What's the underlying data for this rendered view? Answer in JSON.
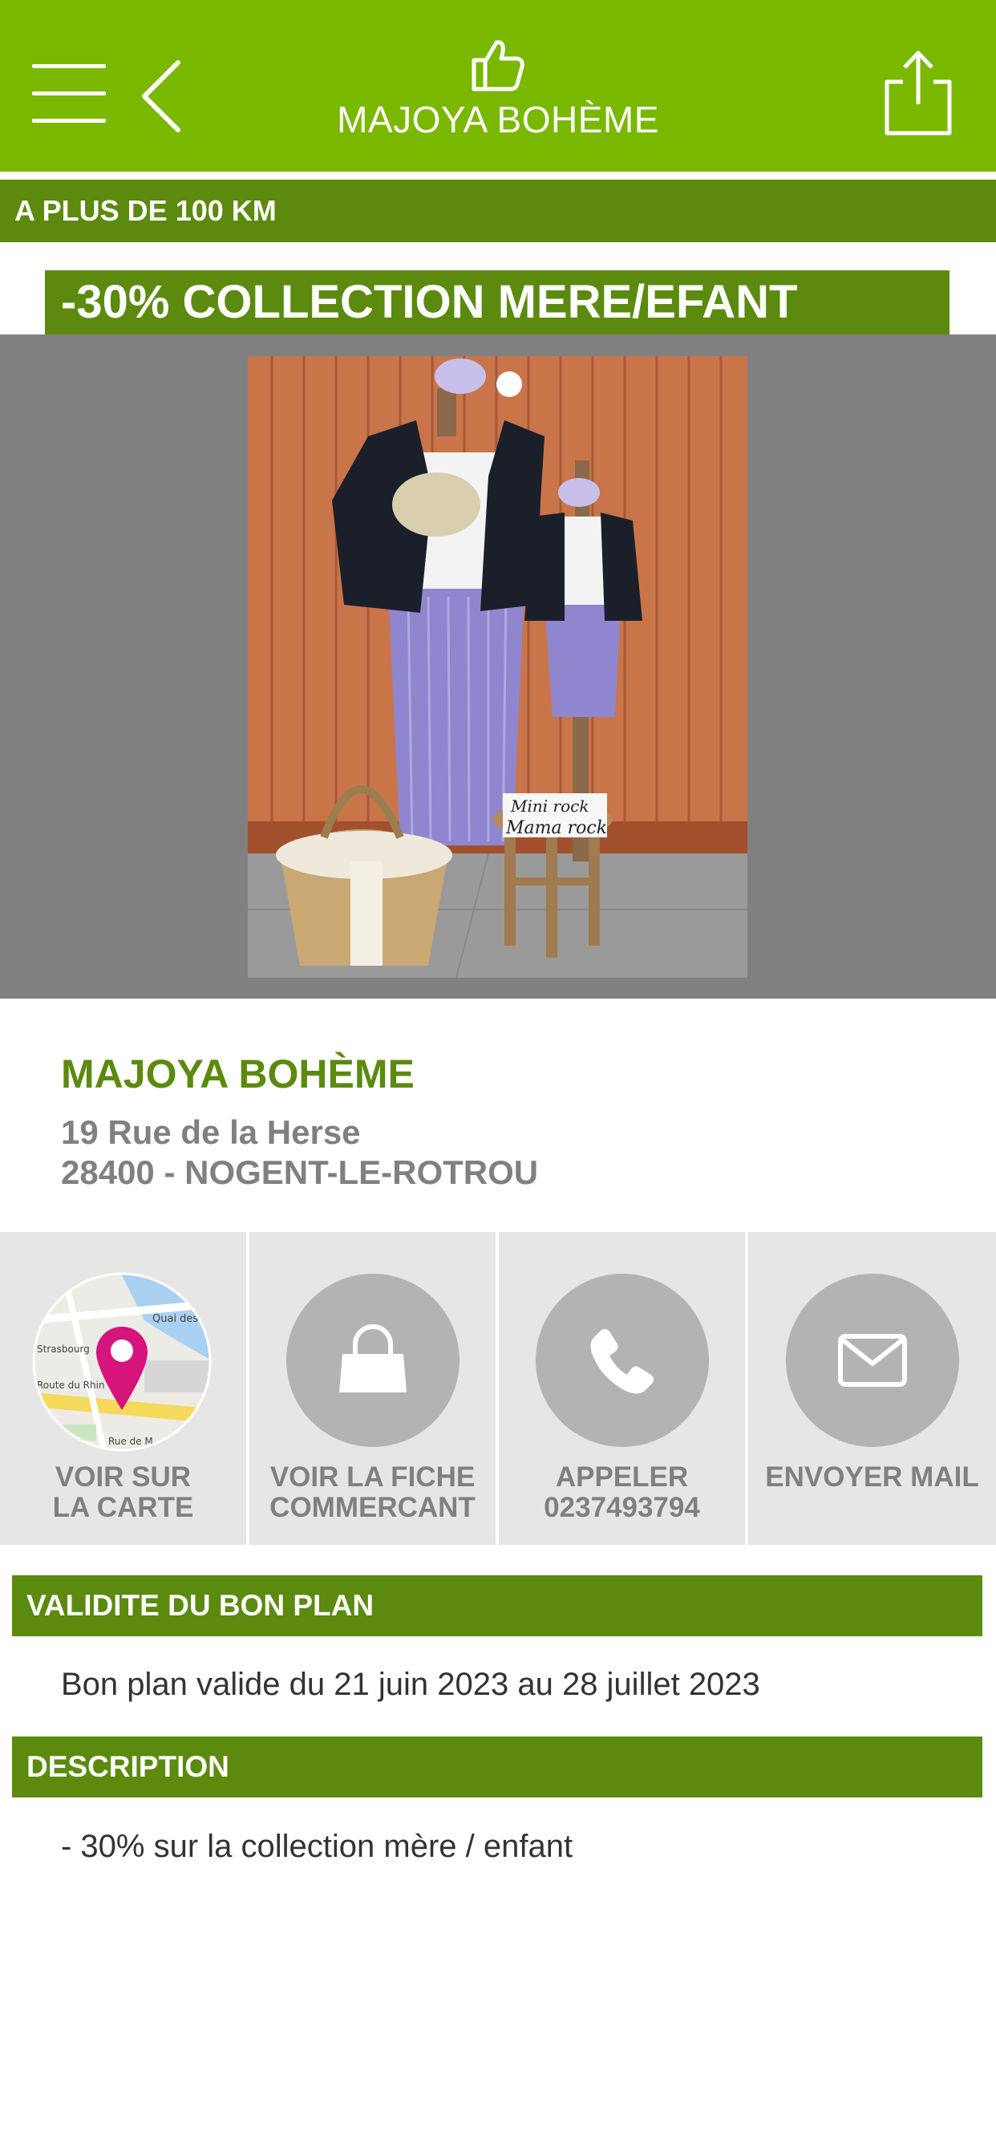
{
  "header": {
    "title": "MAJOYA BOHÈME",
    "icons": {
      "menu": "menu-icon",
      "back": "back-icon",
      "like": "thumbs-up-icon",
      "share": "share-icon"
    },
    "background_color": "#7ab800"
  },
  "distance": {
    "label": "A PLUS DE 100 KM"
  },
  "deal": {
    "title": "-30% COLLECTION MERE/EFANT"
  },
  "carousel": {
    "current_slide": 1
  },
  "store": {
    "name": "MAJOYA BOHÈME",
    "address_line1": "19 Rue de la Herse",
    "address_line2": "28400 - NOGENT-LE-ROTROU",
    "map_labels": [
      "Quai des Alp",
      "Strasbourg",
      "Route du Rhin",
      "Rue de M"
    ]
  },
  "actions": {
    "map": {
      "line1": "VOIR SUR",
      "line2": "LA CARTE",
      "icon": "map-pin-icon"
    },
    "sheet": {
      "line1": "VOIR LA FICHE",
      "line2": "COMMERCANT",
      "icon": "shopping-bag-icon"
    },
    "call": {
      "line1": "APPELER",
      "line2": "0237493794",
      "icon": "phone-icon"
    },
    "mail": {
      "line1": "ENVOYER MAIL",
      "icon": "envelope-icon"
    }
  },
  "validity": {
    "heading": "VALIDITE DU BON PLAN",
    "text": "Bon plan valide du 21 juin 2023 au 28 juillet 2023"
  },
  "description": {
    "heading": "DESCRIPTION",
    "text": "- 30% sur la collection mère / enfant"
  },
  "photo": {
    "shirt_text_1": "Mini rock",
    "shirt_text_2": "Mama rock"
  },
  "colors": {
    "brand_green": "#7ab800",
    "dark_green": "#5b8a0f",
    "accent_pink": "#d5147c",
    "accent_blue": "#1a9ee0"
  }
}
